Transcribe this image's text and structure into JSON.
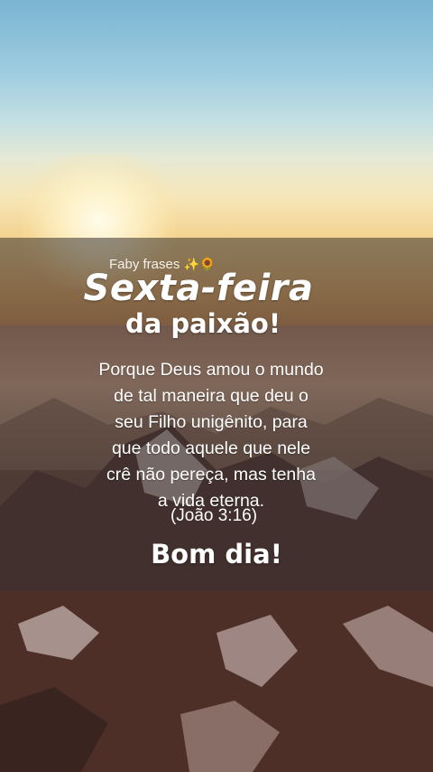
{
  "brand": {
    "label": "Faby frases",
    "emoji": "✨🌻"
  },
  "card": {
    "title": "Sexta-feira",
    "subtitle": "da paixão!",
    "verse_lines": [
      "Porque Deus amou o mundo",
      "de tal maneira que deu o",
      "seu Filho unigênito, para",
      "que todo aquele que nele",
      "crê não pereça, mas tenha",
      "a vida eterna."
    ],
    "reference": "(João 3:16)",
    "greeting": "Bom dia!"
  },
  "colors": {
    "overlay": "#373232",
    "text": "#ffffff",
    "sky_top": "#7ab4d2",
    "sun": "#fff6d5"
  }
}
